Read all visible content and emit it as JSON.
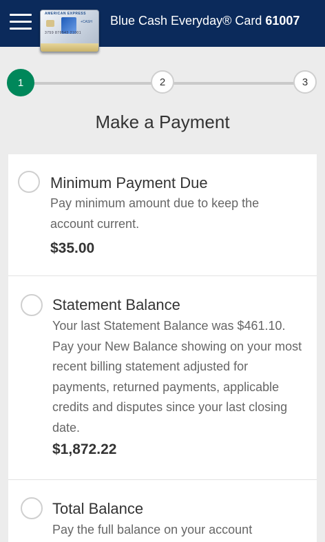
{
  "header": {
    "card_name": "Blue Cash Everyday® Card",
    "card_number": "61007",
    "card_image": {
      "brand_text": "AMERICAN EXPRESS",
      "number_text": "3759 876543 21001",
      "cash_text": "+CASH"
    }
  },
  "stepper": {
    "steps": [
      "1",
      "2",
      "3"
    ],
    "current": 1
  },
  "page": {
    "title": "Make a Payment"
  },
  "options": [
    {
      "title": "Minimum Payment Due",
      "description": "Pay minimum amount due to keep the account current.",
      "amount": "$35.00"
    },
    {
      "title": "Statement Balance",
      "description": "Your last Statement Balance was $461.10. Pay your New Balance showing on your most recent billing statement adjusted for payments, returned payments, applicable credits and disputes since your last closing date.",
      "amount": "$1,872.22"
    },
    {
      "title": "Total Balance",
      "description": "Pay the full balance on your account"
    }
  ],
  "colors": {
    "header_bg": "#0b2a5b",
    "step_active": "#00875a",
    "page_bg": "#ececec"
  }
}
